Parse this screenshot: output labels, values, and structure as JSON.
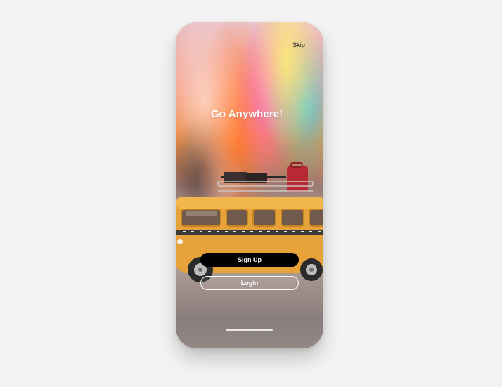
{
  "onboarding": {
    "skip_label": "Skip",
    "headline": "Go Anywhere!",
    "signup_label": "Sign Up",
    "login_label": "Login"
  }
}
